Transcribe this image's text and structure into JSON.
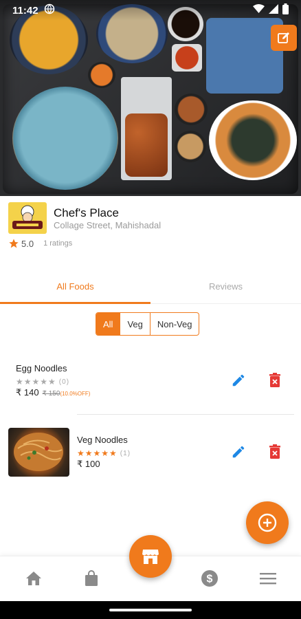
{
  "status": {
    "time": "11:42"
  },
  "restaurant": {
    "name": "Chef's Place",
    "address": "Collage Street, Mahishadal",
    "rating": "5.0",
    "ratings_count": "1 ratings"
  },
  "tabs": [
    {
      "label": "All Foods",
      "active": true
    },
    {
      "label": "Reviews",
      "active": false
    }
  ],
  "filter": {
    "options": [
      "All",
      "Veg",
      "Non-Veg"
    ],
    "selected": "All"
  },
  "items": [
    {
      "name": "Egg Noodles",
      "stars": 0,
      "rating_count": "(0)",
      "price": "₹ 140",
      "old_price": "₹ 150",
      "discount": "(10.0%OFF)"
    },
    {
      "name": "Veg Noodles",
      "stars": 5,
      "rating_count": "(1)",
      "price": "₹ 100"
    }
  ],
  "nav": [
    "home-icon",
    "bag-icon",
    "store-icon",
    "dollar-icon",
    "menu-icon"
  ],
  "colors": {
    "accent": "#f07a1c",
    "delete": "#e53935",
    "edit": "#1e88e5"
  }
}
